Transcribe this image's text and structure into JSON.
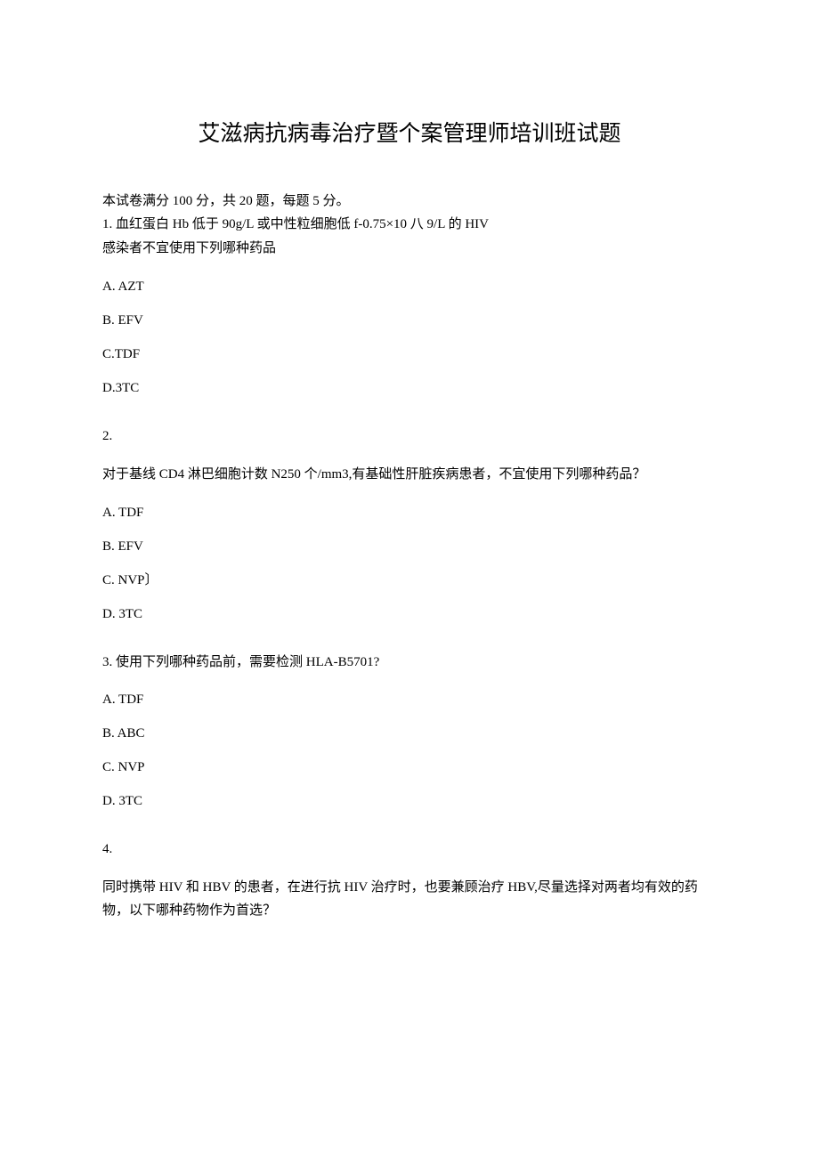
{
  "title": "艾滋病抗病毒治疗暨个案管理师培训班试题",
  "instructions": "本试卷满分 100 分，共 20 题，每题 5 分。",
  "q1": {
    "stem_line1": "1. 血红蛋白 Hb 低于 90g/L 或中性粒细胞低 f-0.75×10 八 9/L 的 HIV",
    "stem_line2": "感染者不宜使用下列哪种药品",
    "optA": "A.   AZT",
    "optB": "B.   EFV",
    "optC": "C.TDF",
    "optD": "D.3TC"
  },
  "q2": {
    "number": "2.",
    "stem": "对于基线 CD4 淋巴细胞计数 N250 个/mm3,有基础性肝脏疾病患者，不宜使用下列哪种药品？",
    "optA": "A.   TDF",
    "optB": "B.   EFV",
    "optC": "C.   NVP〕",
    "optD": "D.   3TC"
  },
  "q3": {
    "stem": "3. 使用下列哪种药品前，需要检测 HLA-B5701?",
    "optA": "A.   TDF",
    "optB": "B.   ABC",
    "optC": "C.   NVP",
    "optD": "D.   3TC"
  },
  "q4": {
    "number": "4.",
    "stem": "同时携带 HIV 和 HBV 的患者，在进行抗 HIV 治疗时，也要兼顾治疗 HBV,尽量选择对两者均有效的药物，以下哪种药物作为首选？"
  }
}
